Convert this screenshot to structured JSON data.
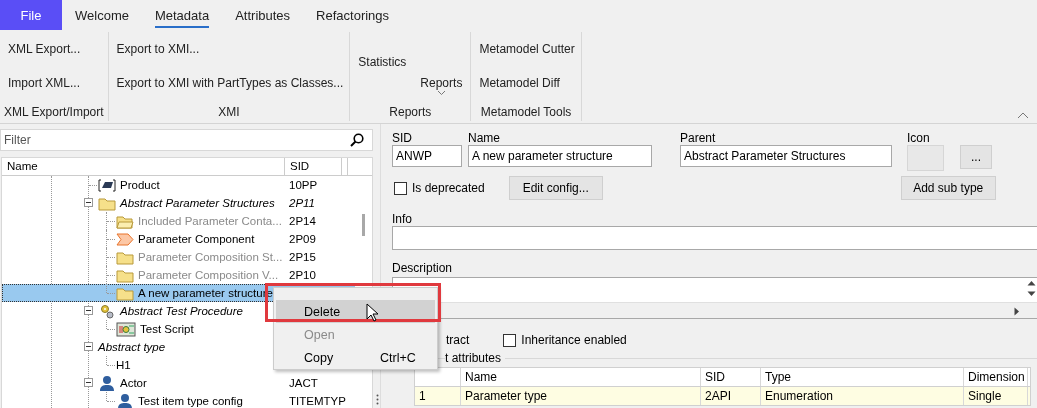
{
  "tabs": [
    {
      "label": "File",
      "kind": "file",
      "selected": false
    },
    {
      "label": "Welcome",
      "kind": "tab",
      "selected": false
    },
    {
      "label": "Metadata",
      "kind": "tab",
      "selected": true
    },
    {
      "label": "Attributes",
      "kind": "tab",
      "selected": false
    },
    {
      "label": "Refactorings",
      "kind": "tab",
      "selected": false
    }
  ],
  "ribbon": {
    "groups": [
      {
        "label": "XML Export/Import",
        "items": [
          {
            "label": "XML Export...",
            "kind": "small"
          },
          {
            "label": "Import XML...",
            "kind": "small"
          }
        ]
      },
      {
        "label": "XMI",
        "items": [
          {
            "label": "Export to XMI...",
            "kind": "small"
          },
          {
            "label": "Export to XMI with PartTypes as Classes...",
            "kind": "small"
          }
        ]
      },
      {
        "label": "Reports",
        "items": [
          {
            "label": "Statistics",
            "kind": "plain"
          },
          {
            "label": "Reports",
            "kind": "dropdown"
          }
        ]
      },
      {
        "label": "Metamodel Tools",
        "items": [
          {
            "label": "Metamodel Cutter",
            "kind": "small"
          },
          {
            "label": "Metamodel Diff",
            "kind": "small"
          }
        ]
      }
    ]
  },
  "filter": {
    "placeholder": "Filter"
  },
  "tree": {
    "columns": [
      "Name",
      "SID"
    ],
    "items": [
      {
        "label": "Product",
        "sid": "10PP",
        "kind": "device",
        "selected": false
      },
      {
        "label": "Abstract Parameter Structures",
        "sid": "2P11",
        "kind": "folder",
        "abstract": true,
        "expanded": true,
        "selected": false,
        "children": [
          {
            "label": "Included Parameter Conta...",
            "sid": "2P14",
            "kind": "folder-open",
            "disabled": true,
            "selected": false
          },
          {
            "label": "Parameter Component",
            "sid": "2P09",
            "kind": "component",
            "selected": false
          },
          {
            "label": "Parameter Composition St...",
            "sid": "2P15",
            "kind": "folder",
            "disabled": true,
            "selected": false
          },
          {
            "label": "Parameter Composition V...",
            "sid": "2P10",
            "kind": "folder",
            "disabled": true,
            "selected": false
          },
          {
            "label": "A new parameter structure",
            "kind": "folder",
            "selected": true
          }
        ]
      },
      {
        "label": "Abstract Test Procedure",
        "kind": "gears",
        "abstract": true,
        "expanded": true,
        "selected": false,
        "children": [
          {
            "label": "Test Script",
            "kind": "script",
            "selected": false
          }
        ]
      },
      {
        "label": "Abstract type",
        "abstract": true,
        "expanded": true,
        "selected": false,
        "children": [
          {
            "label": "H1",
            "selected": false
          }
        ]
      },
      {
        "label": "Actor",
        "sid": "JACT",
        "kind": "person",
        "expanded": true,
        "selected": false,
        "children": [
          {
            "label": "Test item type config",
            "sid": "TITEMTYP",
            "kind": "person",
            "selected": false
          }
        ]
      }
    ]
  },
  "details": {
    "fields": [
      {
        "label": "SID",
        "value": "ANWP"
      },
      {
        "label": "Name",
        "value": "A new parameter structure"
      },
      {
        "label": "Parent",
        "value": "Abstract Parameter Structures"
      }
    ],
    "icon_label": "Icon",
    "icon_button": "...",
    "deprecated": {
      "label": "Is deprecated",
      "checked": false
    },
    "edit_config": "Edit config...",
    "add_sub_type": "Add sub type",
    "info_label": "Info",
    "description_label": "Description",
    "abstract_label": "tract",
    "inheritance": {
      "label": "Inheritance enabled",
      "checked": false
    },
    "attributes": {
      "title": "t attributes",
      "columns": [
        "Name",
        "SID",
        "Type",
        "Dimension"
      ],
      "rows": [
        {
          "number": "1",
          "name": "Parameter type",
          "sid": "2API",
          "type": "Enumeration",
          "dimension": "Single"
        }
      ]
    }
  },
  "context_menu": {
    "items": [
      {
        "label": "Delete",
        "selected": true,
        "disabled": false
      },
      {
        "label": "Open",
        "selected": false,
        "disabled": true
      },
      {
        "label": "Copy",
        "shortcut": "Ctrl+C",
        "selected": false,
        "disabled": false
      }
    ]
  }
}
